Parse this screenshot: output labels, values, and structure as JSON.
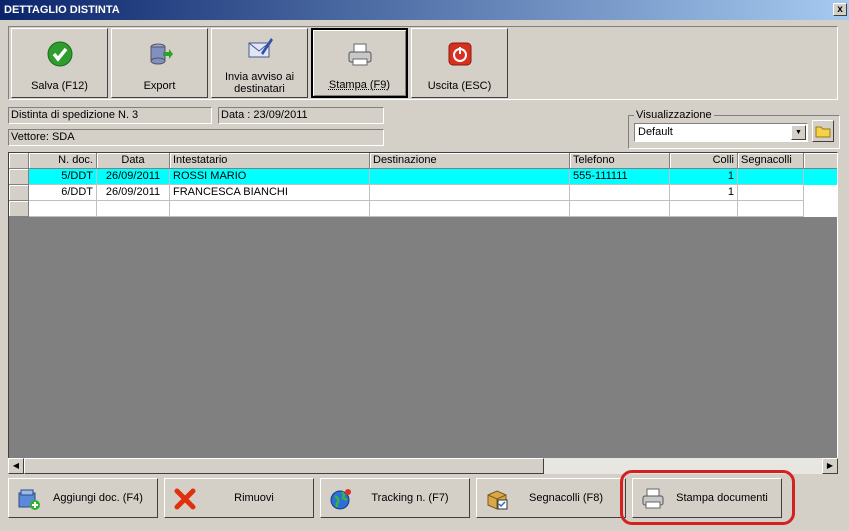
{
  "window": {
    "title": "DETTAGLIO DISTINTA",
    "close_label": "x"
  },
  "toolbar": {
    "buttons": [
      {
        "label": "Salva (F12)",
        "icon": "checkmark-icon"
      },
      {
        "label": "Export",
        "icon": "database-export-icon"
      },
      {
        "label": "Invia avviso ai destinatari",
        "icon": "email-envelope-icon"
      },
      {
        "label": "Stampa (F9)",
        "icon": "printer-icon"
      },
      {
        "label": "Uscita (ESC)",
        "icon": "exit-power-icon"
      }
    ]
  },
  "info": {
    "distinta": "Distinta di spedizione N. 3",
    "data": "Data : 23/09/2011",
    "vettore": "Vettore: SDA"
  },
  "view": {
    "legend": "Visualizzazione",
    "selected": "Default"
  },
  "grid": {
    "columns": [
      "N. doc.",
      "Data",
      "Intestatario",
      "Destinazione",
      "Telefono",
      "Colli",
      "Segnacolli"
    ],
    "rows": [
      {
        "ndoc": "5/DDT",
        "data": "26/09/2011",
        "intestatario": "ROSSI MARIO",
        "destinazione": "",
        "telefono": "555-111111",
        "colli": "1",
        "segnacolli": ""
      },
      {
        "ndoc": "6/DDT",
        "data": "26/09/2011",
        "intestatario": "FRANCESCA BIANCHI",
        "destinazione": "",
        "telefono": "",
        "colli": "1",
        "segnacolli": ""
      }
    ]
  },
  "bottom": {
    "aggiungi": "Aggiungi doc. (F4)",
    "rimuovi": "Rimuovi",
    "tracking": "Tracking n. (F7)",
    "segnacolli": "Segnacolli (F8)",
    "stampa_documenti": "Stampa documenti"
  },
  "colors": {
    "highlight_row": "#00ffff",
    "annotation": "#d42020",
    "title_bar": "#0a246a"
  }
}
